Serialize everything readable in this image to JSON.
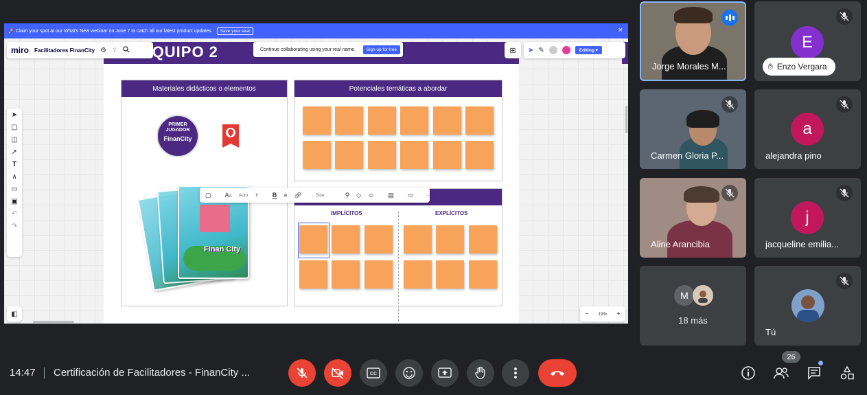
{
  "share": {
    "banner_text": "🚀 Claim your spot at our What's New webinar on June 7 to catch all our latest product updates.",
    "banner_button": "Save your seat",
    "banner_close": "×",
    "logo": "miro",
    "board_name": "Facilitadores FinanCity",
    "collab_text": "Continue collaborating using your real name.",
    "signup": "Sign up for free",
    "editing": "Editing ▾",
    "frame_title": "EQUIPO 2",
    "panel_materiales": "Materiales didácticos o elementos",
    "panel_tematicas": "Potenciales temáticas a abordar",
    "col_implicitos": "IMPLÍCITOS",
    "col_explicitos": "EXPLÍCITOS",
    "badge_line1": "PRIMER",
    "badge_line2": "JUGADOR",
    "badge_logo": "FinanCity",
    "card_logo": "Finan City",
    "ctx_auto": "Auto",
    "ctx_size": "Size",
    "zoom_minus": "−",
    "zoom_pct": "19%",
    "zoom_plus": "+"
  },
  "participants": [
    {
      "name": "Jorge Morales M...",
      "kind": "video"
    },
    {
      "name": "Enzo Vergara",
      "kind": "avatar",
      "initial": "E",
      "color": "#8430ce"
    },
    {
      "name": "Carmen Gloria P...",
      "kind": "video"
    },
    {
      "name": "alejandra pino",
      "kind": "avatar",
      "initial": "a",
      "color": "#c2185b"
    },
    {
      "name": "Aline Arancibia",
      "kind": "video"
    },
    {
      "name": "jacqueline emilia...",
      "kind": "avatar",
      "initial": "j",
      "color": "#c2185b"
    },
    {
      "name": "18 más",
      "kind": "more",
      "initial": "M"
    },
    {
      "name": "Tú",
      "kind": "self"
    }
  ],
  "bottom": {
    "time": "14:47",
    "meeting_title": "Certificación de Facilitadores - FinanCity ...",
    "people_count": "26"
  }
}
